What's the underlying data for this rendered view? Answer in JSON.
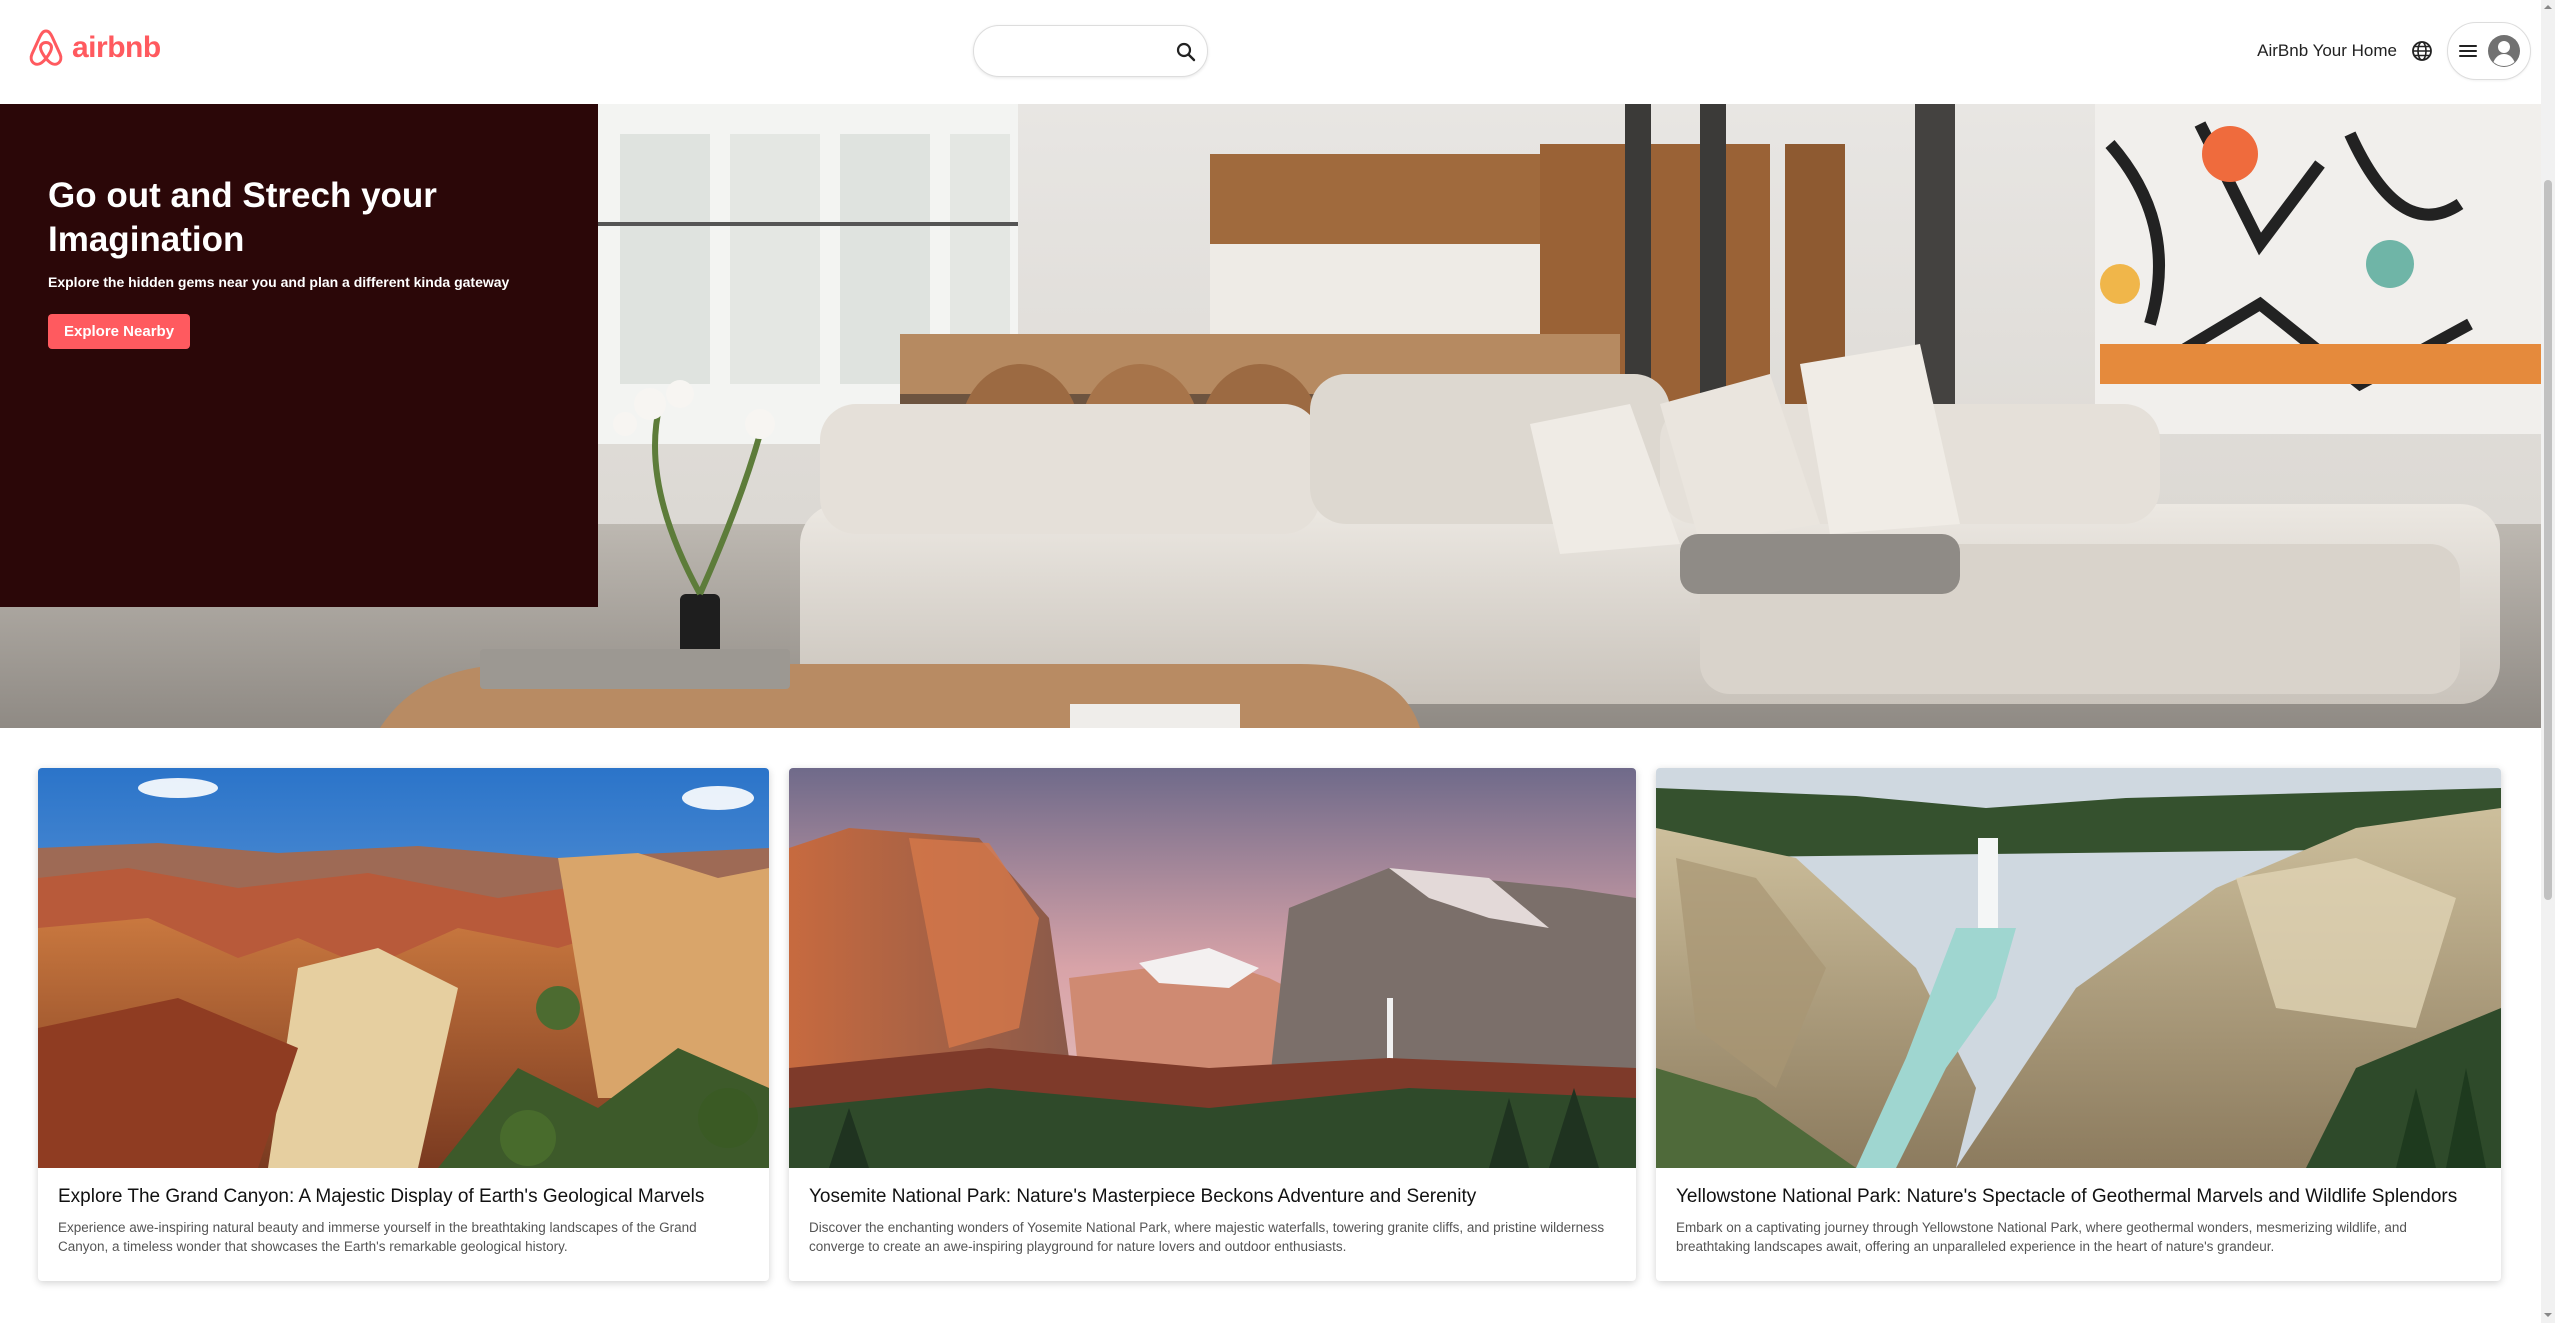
{
  "header": {
    "logo_text": "airbnb",
    "search_placeholder": "",
    "host_link": "AirBnb Your Home",
    "icons": {
      "logo": "airbnb-logo-icon",
      "search": "search-icon",
      "globe": "globe-icon",
      "menu": "hamburger-menu-icon",
      "avatar": "user-avatar-icon"
    }
  },
  "hero": {
    "title": "Go out and Strech your Imagination",
    "subtitle": "Explore the hidden gems near you and plan a different kinda gateway",
    "button": "Explore Nearby"
  },
  "cards": [
    {
      "title": "Explore The Grand Canyon: A Majestic Display of Earth's Geological Marvels",
      "description": "Experience awe-inspiring natural beauty and immerse yourself in the breathtaking landscapes of the Grand Canyon, a timeless wonder that showcases the Earth's remarkable geological history."
    },
    {
      "title": "Yosemite National Park: Nature's Masterpiece Beckons Adventure and Serenity",
      "description": "Discover the enchanting wonders of Yosemite National Park, where majestic waterfalls, towering granite cliffs, and pristine wilderness converge to create an awe-inspiring playground for nature lovers and outdoor enthusiasts."
    },
    {
      "title": "Yellowstone National Park: Nature's Spectacle of Geothermal Marvels and Wildlife Splendors",
      "description": "Embark on a captivating journey through Yellowstone National Park, where geothermal wonders, mesmerizing wildlife, and breathtaking landscapes await, offering an unparalleled experience in the heart of nature's grandeur."
    }
  ],
  "colors": {
    "brand": "#ff5a5f",
    "hero_panel": "#2b0708",
    "text": "#222222"
  }
}
